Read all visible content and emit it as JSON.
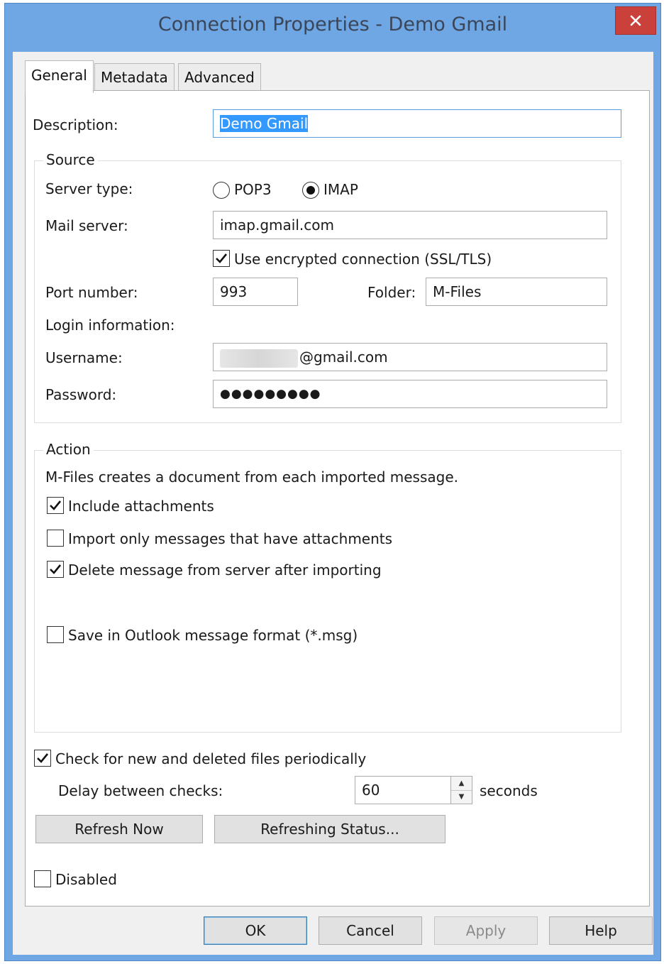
{
  "window": {
    "title": "Connection Properties - Demo Gmail"
  },
  "tabs": [
    "General",
    "Metadata",
    "Advanced"
  ],
  "description": {
    "label": "Description:",
    "value": "Demo Gmail"
  },
  "source": {
    "group_title": "Source",
    "server_type_label": "Server type:",
    "pop3_label": "POP3",
    "imap_label": "IMAP",
    "selected_server_type": "IMAP",
    "mail_server_label": "Mail server:",
    "mail_server_value": "imap.gmail.com",
    "encrypted_label": "Use encrypted connection (SSL/TLS)",
    "encrypted_checked": true,
    "port_label": "Port number:",
    "port_value": "993",
    "folder_label": "Folder:",
    "folder_value": "M-Files",
    "login_label": "Login information:",
    "username_label": "Username:",
    "username_suffix": "@gmail.com",
    "password_label": "Password:",
    "password_mask": "●●●●●●●●●"
  },
  "action": {
    "group_title": "Action",
    "description": "M-Files creates a document from each imported message.",
    "include_attachments_label": "Include attachments",
    "include_attachments_checked": true,
    "import_only_label": "Import only messages that have attachments",
    "import_only_checked": false,
    "delete_label": "Delete message from server after importing",
    "delete_checked": true,
    "save_msg_label": "Save in Outlook message format (*.msg)",
    "save_msg_checked": false
  },
  "periodic": {
    "check_label": "Check for new and deleted files periodically",
    "check_checked": true,
    "delay_label": "Delay between checks:",
    "delay_value": "60",
    "delay_unit": "seconds"
  },
  "buttons": {
    "refresh_now": "Refresh Now",
    "refreshing_status": "Refreshing Status...",
    "ok": "OK",
    "cancel": "Cancel",
    "apply": "Apply",
    "help": "Help"
  },
  "disabled": {
    "label": "Disabled",
    "checked": false
  },
  "icons": {
    "close": "close-icon",
    "check": "check-icon",
    "spin_up": "spin-up-icon",
    "spin_down": "spin-down-icon"
  },
  "colors": {
    "window_frame": "#6fa6e4",
    "close_button": "#c9413a",
    "selection": "#3399ff"
  }
}
